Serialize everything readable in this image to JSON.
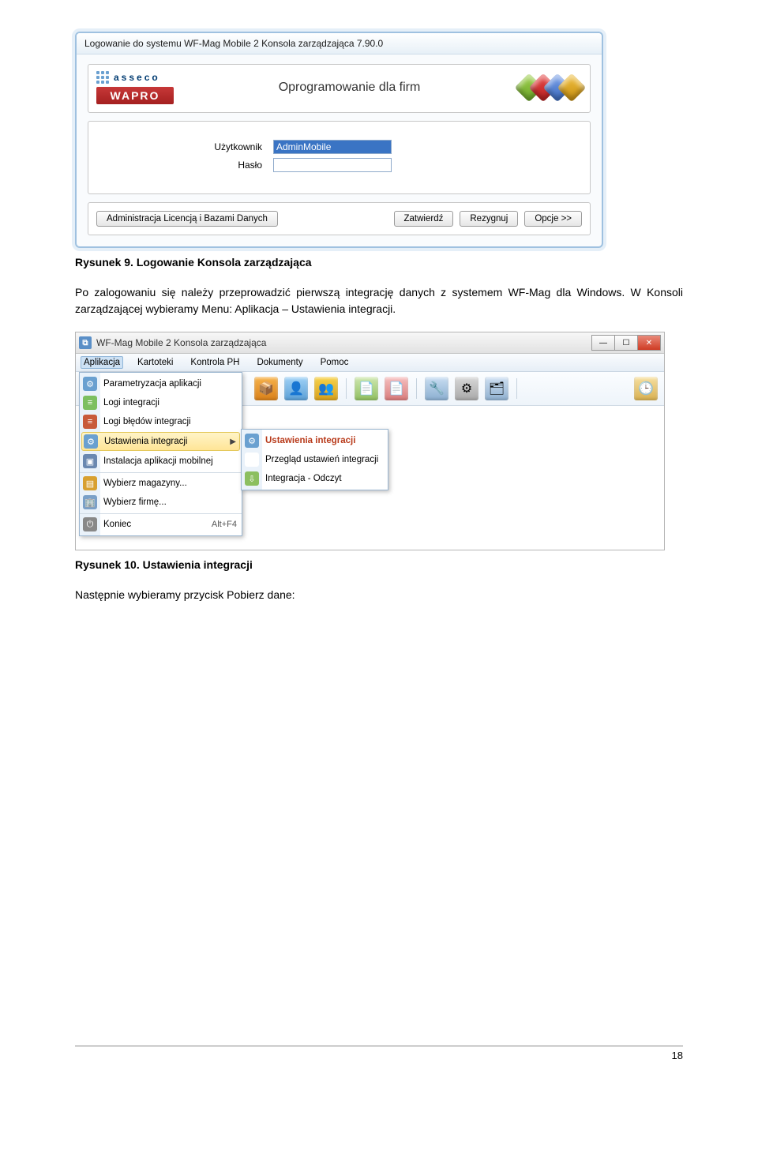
{
  "login": {
    "titlebar": "Logowanie do systemu WF-Mag Mobile 2 Konsola zarządzająca 7.90.0",
    "brand_asseco": "asseco",
    "brand_wapro": "WAPRO",
    "tagline": "Oprogramowanie dla firm",
    "user_label": "Użytkownik",
    "user_value": "AdminMobile",
    "pass_label": "Hasło",
    "pass_value": "",
    "btn_admin": "Administracja Licencją i Bazami Danych",
    "btn_ok": "Zatwierdź",
    "btn_cancel": "Rezygnuj",
    "btn_opts": "Opcje >>"
  },
  "caption1": "Rysunek 9. Logowanie Konsola zarządzająca",
  "para1": "Po zalogowaniu się należy przeprowadzić pierwszą integrację danych z systemem WF-Mag dla Windows. W Konsoli zarządzającej wybieramy Menu: Aplikacja – Ustawienia integracji.",
  "console": {
    "title": "WF-Mag Mobile 2 Konsola zarządzająca",
    "menubar": [
      "Aplikacja",
      "Kartoteki",
      "Kontrola PH",
      "Dokumenty",
      "Pomoc"
    ],
    "menu_items": [
      {
        "label": "Parametryzacja aplikacji"
      },
      {
        "label": "Logi integracji"
      },
      {
        "label": "Logi błędów integracji"
      },
      {
        "label": "Ustawienia integracji"
      },
      {
        "label": "Instalacja aplikacji mobilnej"
      },
      {
        "label": "Wybierz magazyny..."
      },
      {
        "label": "Wybierz firmę..."
      },
      {
        "label": "Koniec",
        "shortcut": "Alt+F4"
      }
    ],
    "submenu": {
      "title": "Ustawienia integracji",
      "items": [
        "Przegląd ustawień integracji",
        "Integracja - Odczyt"
      ]
    }
  },
  "caption2": "Rysunek 10. Ustawienia integracji",
  "para2": "Następnie wybieramy przycisk Pobierz dane:",
  "pagenum": "18"
}
